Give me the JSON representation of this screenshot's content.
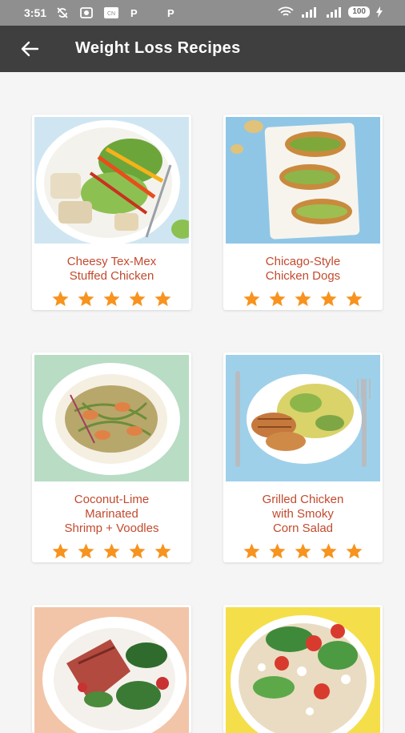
{
  "status_bar": {
    "time": "3:51",
    "icons": [
      "sync-off-icon",
      "camera-icon",
      "cn-icon",
      "p-icon",
      "p-icon"
    ],
    "battery": "100"
  },
  "app_bar": {
    "title": "Weight Loss Recipes",
    "back_icon": "arrow-back-icon"
  },
  "recipes": [
    {
      "title": "Cheesy Tex-Mex\nStuffed Chicken",
      "rating": 5,
      "image": "chicken-salad-plate"
    },
    {
      "title": "Chicago-Style\nChicken Dogs",
      "rating": 5,
      "image": "chicken-hot-dogs"
    },
    {
      "title": "Coconut-Lime\nMarinated\nShrimp + Voodles",
      "rating": 5,
      "image": "shrimp-noodles-plate"
    },
    {
      "title": "Grilled Chicken\nwith Smoky\nCorn Salad",
      "rating": 5,
      "image": "grilled-chicken-corn-plate"
    },
    {
      "title": "",
      "rating": 0,
      "image": "steak-salad-plate"
    },
    {
      "title": "",
      "rating": 0,
      "image": "grain-salad-plate"
    }
  ],
  "colors": {
    "status_bar": "#8f8f8f",
    "app_bar": "#3f3f3f",
    "title_text": "#c24a2e",
    "star": "#f7931e"
  }
}
